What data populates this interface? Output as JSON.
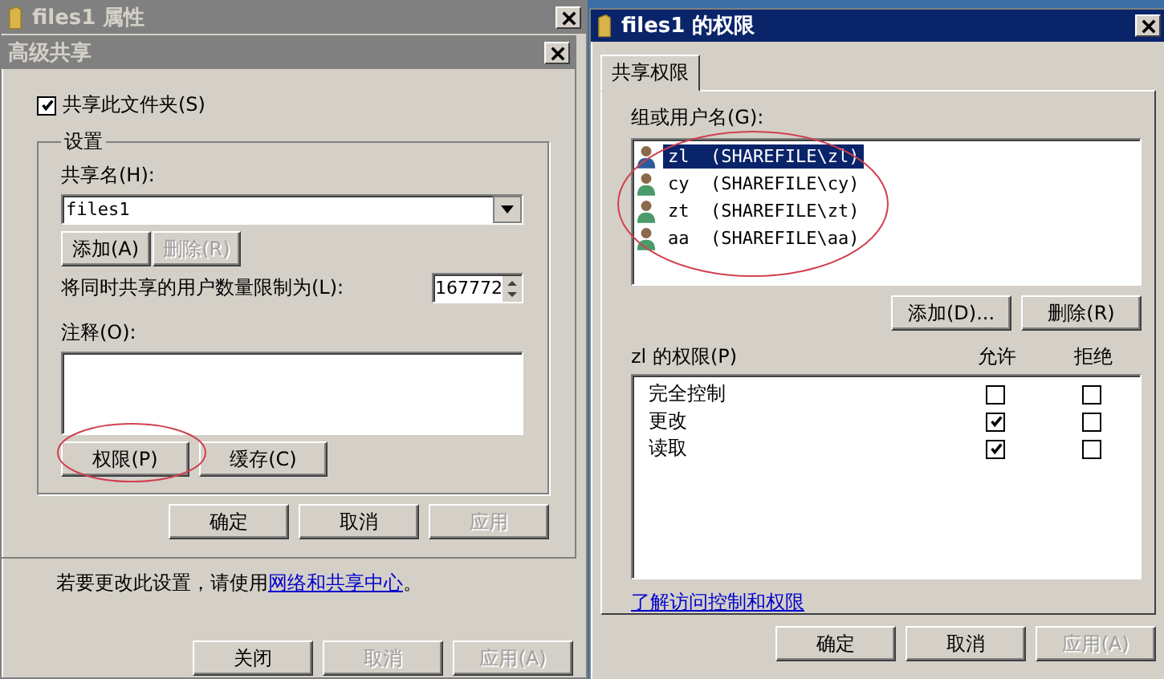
{
  "properties_window": {
    "title": "files1 属性",
    "notice": "若要更改此设置，请使用",
    "notice_link": "网络和共享中心",
    "notice_end": "。",
    "buttons": [
      {
        "label": "关闭",
        "disabled": false
      },
      {
        "label": "取消",
        "disabled": true
      },
      {
        "label": "应用(A)",
        "disabled": true
      }
    ]
  },
  "advanced_sharing": {
    "title": "高级共享",
    "share_checkbox": {
      "label": "共享此文件夹(S)",
      "checked": true
    },
    "settings_legend": "设置",
    "share_name_label": "共享名(H):",
    "share_name": "files1",
    "name_buttons": [
      {
        "label": "添加(A)",
        "disabled": false
      },
      {
        "label": "删除(R)",
        "disabled": true
      }
    ],
    "limit_label": "将同时共享的用户数量限制为(L):",
    "limit_value": "167772",
    "comment_label": "注释(O):",
    "action_buttons": [
      {
        "label": "权限(P)",
        "highlighted": true
      },
      {
        "label": "缓存(C)",
        "highlighted": false
      }
    ],
    "buttons": [
      {
        "label": "确定",
        "disabled": false
      },
      {
        "label": "取消",
        "disabled": false
      },
      {
        "label": "应用",
        "disabled": true
      }
    ]
  },
  "permissions_window": {
    "title": "files1 的权限",
    "tabs": [
      {
        "label": "共享权限",
        "selected": true
      }
    ],
    "users_label": "组或用户名(G):",
    "users_highlighted": true,
    "users": [
      {
        "name": "zl  (SHAREFILE\\zl)",
        "selected": true
      },
      {
        "name": "cy  (SHAREFILE\\cy)",
        "selected": false
      },
      {
        "name": "zt  (SHAREFILE\\zt)",
        "selected": false
      },
      {
        "name": "aa  (SHAREFILE\\aa)",
        "selected": false
      }
    ],
    "user_buttons": [
      {
        "label": "添加(D)...",
        "disabled": false
      },
      {
        "label": "删除(R)",
        "disabled": false
      }
    ],
    "permissions_label": "zl 的权限(P)",
    "allow_header": "允许",
    "deny_header": "拒绝",
    "permissions": [
      {
        "name": "完全控制",
        "allow": false,
        "deny": false
      },
      {
        "name": "更改",
        "allow": true,
        "deny": false
      },
      {
        "name": "读取",
        "allow": true,
        "deny": false
      }
    ],
    "link": "了解访问控制和权限",
    "buttons": [
      {
        "label": "确定",
        "disabled": false
      },
      {
        "label": "取消",
        "disabled": false
      },
      {
        "label": "应用(A)",
        "disabled": true
      }
    ]
  }
}
